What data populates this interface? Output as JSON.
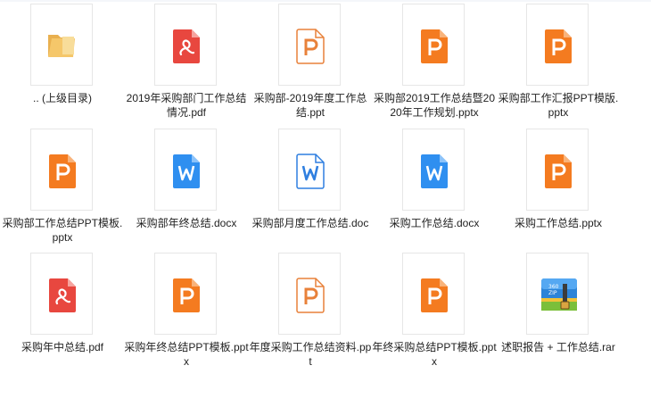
{
  "files": [
    {
      "name": ".. (上级目录)",
      "icon": "folder-icon"
    },
    {
      "name": "2019年采购部门工作总结情况.pdf",
      "icon": "pdf-icon"
    },
    {
      "name": "采购部-2019年度工作总结.ppt",
      "icon": "ppt-icon"
    },
    {
      "name": "采购部2019工作总结暨2020年工作规划.pptx",
      "icon": "pptx-icon"
    },
    {
      "name": "采购部工作汇报PPT模版.pptx",
      "icon": "pptx-icon"
    },
    {
      "name": "采购部工作总结PPT模板.pptx",
      "icon": "pptx-icon"
    },
    {
      "name": "采购部年终总结.docx",
      "icon": "docx-icon"
    },
    {
      "name": "采购部月度工作总结.doc",
      "icon": "doc-icon"
    },
    {
      "name": "采购工作总结.docx",
      "icon": "docx-icon"
    },
    {
      "name": "采购工作总结.pptx",
      "icon": "pptx-icon"
    },
    {
      "name": "采购年中总结.pdf",
      "icon": "pdf-icon"
    },
    {
      "name": "采购年终总结PPT模板.pptx",
      "icon": "pptx-icon"
    },
    {
      "name": "年度采购工作总结资料.ppt",
      "icon": "ppt-icon"
    },
    {
      "name": "年终采购总结PPT模板.pptx",
      "icon": "pptx-icon"
    },
    {
      "name": "述职报告 + 工作总结.rar",
      "icon": "rar-icon"
    }
  ],
  "colors": {
    "pdf": "#e8473f",
    "pptx": "#f47b20",
    "ppt_outline": "#e8813a",
    "docx": "#2f8ff0",
    "doc_outline": "#2f7fe0",
    "folder": "#f5c76a"
  }
}
